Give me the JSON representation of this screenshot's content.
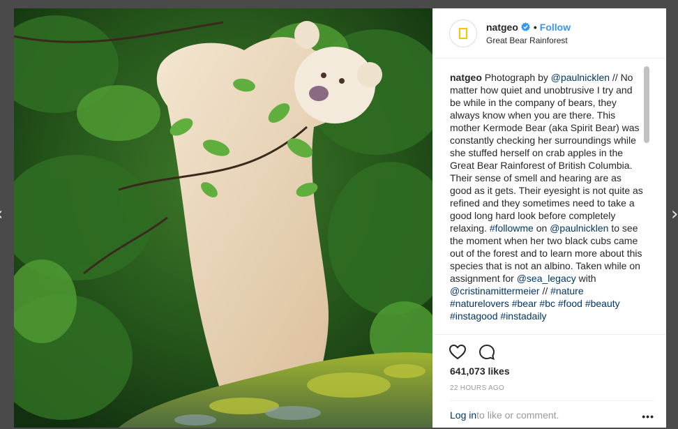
{
  "nav": {
    "prev_icon": "‹",
    "next_icon": "›"
  },
  "post": {
    "username": "natgeo",
    "dot": "•",
    "follow_label": "Follow",
    "location": "Great Bear Rainforest",
    "avatar_text": "NATIONAL GEOGRAPHIC",
    "caption": {
      "user": "natgeo",
      "segments": [
        {
          "text": " Photograph by ",
          "link": false
        },
        {
          "text": "@paulnicklen",
          "link": true
        },
        {
          "text": " // No matter how quiet and unobtrusive I try and be while in the company of bears, they always know when you are there. This mother Kermode Bear (aka Spirit Bear) was constantly checking her surroundings while she stuffed herself on crab apples in the Great Bear Rainforest of British Columbia. Their sense of smell and hearing are as good as it gets. Their eyesight is not quite as refined and they sometimes need to take a good long hard look before completely relaxing. ",
          "link": false
        },
        {
          "text": "#followme",
          "link": true
        },
        {
          "text": " on ",
          "link": false
        },
        {
          "text": "@paulnicklen",
          "link": true
        },
        {
          "text": " to see the moment when her two black cubs came out of the forest and to learn more about this species that is not an albino. Taken while on assignment for ",
          "link": false
        },
        {
          "text": "@sea_legacy",
          "link": true
        },
        {
          "text": " with ",
          "link": false
        },
        {
          "text": "@cristinamittermeier",
          "link": true
        },
        {
          "text": " // ",
          "link": false
        },
        {
          "text": "#nature",
          "link": true
        },
        {
          "text": " ",
          "link": false
        },
        {
          "text": "#naturelovers",
          "link": true
        },
        {
          "text": " ",
          "link": false
        },
        {
          "text": "#bear",
          "link": true
        },
        {
          "text": " ",
          "link": false
        },
        {
          "text": "#bc",
          "link": true
        },
        {
          "text": " ",
          "link": false
        },
        {
          "text": "#food",
          "link": true
        },
        {
          "text": " ",
          "link": false
        },
        {
          "text": "#beauty",
          "link": true
        },
        {
          "text": " ",
          "link": false
        },
        {
          "text": "#instagood",
          "link": true
        },
        {
          "text": " ",
          "link": false
        },
        {
          "text": "#instadaily",
          "link": true
        }
      ]
    },
    "likes": "641,073 likes",
    "time": "22 HOURS AGO",
    "login_link": "Log in",
    "login_suffix": " to like or comment.",
    "more_icon": "•••"
  },
  "colors": {
    "link": "#003569",
    "follow": "#3897f0",
    "verified": "#3897f0",
    "ng_yellow": "#f7c600"
  },
  "icons": {
    "like": "heart-icon",
    "comment": "comment-icon",
    "verified": "verified-badge-icon",
    "more": "more-options-icon"
  }
}
